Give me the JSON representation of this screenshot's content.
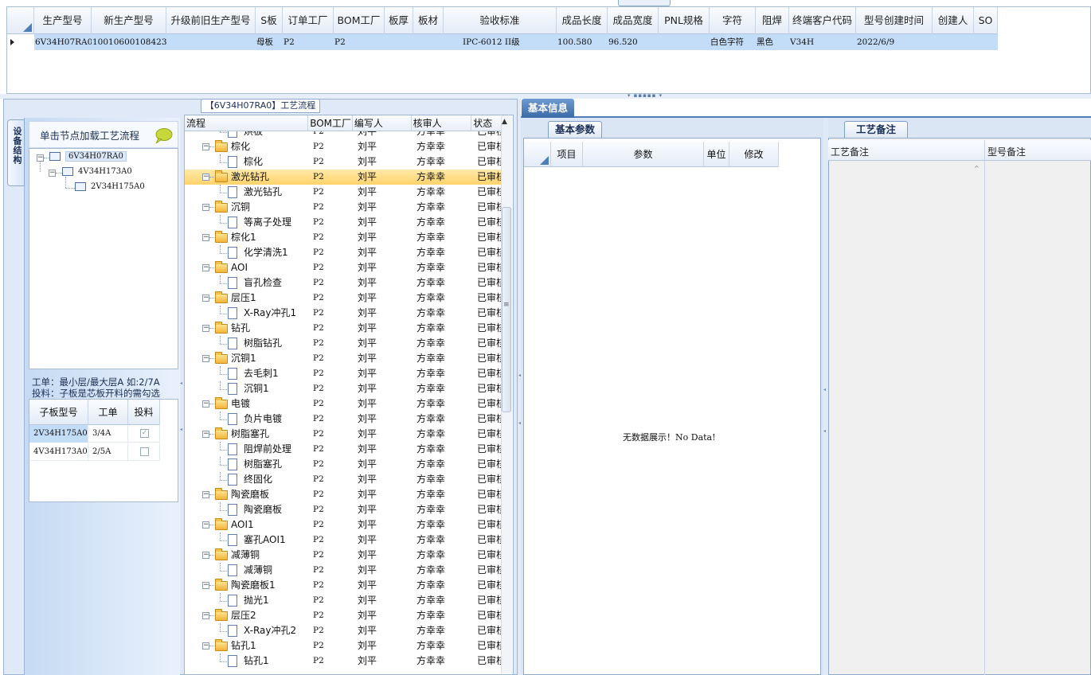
{
  "top_grid": {
    "columns": [
      "生产型号",
      "新生产型号",
      "升级前旧生产型号",
      "S板",
      "订单工厂",
      "BOM工厂",
      "板厚",
      "板材",
      "验收标准",
      "成品长度",
      "成品宽度",
      "PNL规格",
      "字符",
      "阻焊",
      "终端客户代码",
      "型号创建时间",
      "创建人",
      "SO"
    ],
    "row": [
      "6V34H07RA0",
      "10010600108423",
      "",
      "母板",
      "P2",
      "P2",
      "",
      "",
      "IPC-6012 II级",
      "100.580",
      "96.520",
      "",
      "白色字符",
      "黑色",
      "V34H",
      "2022/6/9",
      "",
      ""
    ]
  },
  "left_panel": {
    "caption": "【6V34H07RA0】工艺流程",
    "side_tab": "设备结构",
    "tip": "单击节点加载工艺流程",
    "tree": [
      {
        "label": "6V34H07RA0",
        "level": 0
      },
      {
        "label": "4V34H173A0",
        "level": 1
      },
      {
        "label": "2V34H175A0",
        "level": 2
      }
    ],
    "note_line1": "工单：最小层/最大层A 如:2/7A",
    "note_line2": "投料：子板是芯板开料的需勾选",
    "sub_grid": {
      "columns": [
        "子板型号",
        "工单",
        "投料"
      ],
      "rows": [
        {
          "model": "2V34H175A0",
          "order": "3/4A",
          "feed": true
        },
        {
          "model": "4V34H173A0",
          "order": "2/5A",
          "feed": false
        }
      ]
    }
  },
  "process": {
    "columns": [
      "流程",
      "BOM工厂",
      "编写人",
      "核审人",
      "状态"
    ],
    "rows": [
      {
        "name": "烘板",
        "type": "doc",
        "bom": "P2",
        "writer": "刘平",
        "reviewer": "方幸幸",
        "status": "已审核"
      },
      {
        "name": "棕化",
        "type": "folder",
        "bom": "P2",
        "writer": "刘平",
        "reviewer": "方幸幸",
        "status": "已审核"
      },
      {
        "name": "棕化",
        "type": "doc",
        "bom": "P2",
        "writer": "刘平",
        "reviewer": "方幸幸",
        "status": "已审核"
      },
      {
        "name": "激光钻孔",
        "type": "folder",
        "bom": "P2",
        "writer": "刘平",
        "reviewer": "方幸幸",
        "status": "已审核",
        "selected": true
      },
      {
        "name": "激光钻孔",
        "type": "doc",
        "bom": "P2",
        "writer": "刘平",
        "reviewer": "方幸幸",
        "status": "已审核"
      },
      {
        "name": "沉铜",
        "type": "folder",
        "bom": "P2",
        "writer": "刘平",
        "reviewer": "方幸幸",
        "status": "已审核"
      },
      {
        "name": "等离子处理",
        "type": "doc",
        "bom": "P2",
        "writer": "刘平",
        "reviewer": "方幸幸",
        "status": "已审核"
      },
      {
        "name": "棕化1",
        "type": "folder",
        "bom": "P2",
        "writer": "刘平",
        "reviewer": "方幸幸",
        "status": "已审核"
      },
      {
        "name": "化学清洗1",
        "type": "doc",
        "bom": "P2",
        "writer": "刘平",
        "reviewer": "方幸幸",
        "status": "已审核"
      },
      {
        "name": "AOI",
        "type": "folder",
        "bom": "P2",
        "writer": "刘平",
        "reviewer": "方幸幸",
        "status": "已审核"
      },
      {
        "name": "盲孔检查",
        "type": "doc",
        "bom": "P2",
        "writer": "刘平",
        "reviewer": "方幸幸",
        "status": "已审核"
      },
      {
        "name": "层压1",
        "type": "folder",
        "bom": "P2",
        "writer": "刘平",
        "reviewer": "方幸幸",
        "status": "已审核"
      },
      {
        "name": "X-Ray冲孔1",
        "type": "doc",
        "bom": "P2",
        "writer": "刘平",
        "reviewer": "方幸幸",
        "status": "已审核"
      },
      {
        "name": "钻孔",
        "type": "folder",
        "bom": "P2",
        "writer": "刘平",
        "reviewer": "方幸幸",
        "status": "已审核"
      },
      {
        "name": "树脂钻孔",
        "type": "doc",
        "bom": "P2",
        "writer": "刘平",
        "reviewer": "方幸幸",
        "status": "已审核"
      },
      {
        "name": "沉铜1",
        "type": "folder",
        "bom": "P2",
        "writer": "刘平",
        "reviewer": "方幸幸",
        "status": "已审核"
      },
      {
        "name": "去毛刺1",
        "type": "doc",
        "bom": "P2",
        "writer": "刘平",
        "reviewer": "方幸幸",
        "status": "已审核"
      },
      {
        "name": "沉铜1",
        "type": "doc",
        "bom": "P2",
        "writer": "刘平",
        "reviewer": "方幸幸",
        "status": "已审核"
      },
      {
        "name": "电镀",
        "type": "folder",
        "bom": "P2",
        "writer": "刘平",
        "reviewer": "方幸幸",
        "status": "已审核"
      },
      {
        "name": "负片电镀",
        "type": "doc",
        "bom": "P2",
        "writer": "刘平",
        "reviewer": "方幸幸",
        "status": "已审核"
      },
      {
        "name": "树脂塞孔",
        "type": "folder",
        "bom": "P2",
        "writer": "刘平",
        "reviewer": "方幸幸",
        "status": "已审核"
      },
      {
        "name": "阻焊前处理",
        "type": "doc",
        "bom": "P2",
        "writer": "刘平",
        "reviewer": "方幸幸",
        "status": "已审核"
      },
      {
        "name": "树脂塞孔",
        "type": "doc",
        "bom": "P2",
        "writer": "刘平",
        "reviewer": "方幸幸",
        "status": "已审核"
      },
      {
        "name": "终固化",
        "type": "doc",
        "bom": "P2",
        "writer": "刘平",
        "reviewer": "方幸幸",
        "status": "已审核"
      },
      {
        "name": "陶瓷磨板",
        "type": "folder",
        "bom": "P2",
        "writer": "刘平",
        "reviewer": "方幸幸",
        "status": "已审核"
      },
      {
        "name": "陶瓷磨板",
        "type": "doc",
        "bom": "P2",
        "writer": "刘平",
        "reviewer": "方幸幸",
        "status": "已审核"
      },
      {
        "name": "AOI1",
        "type": "folder",
        "bom": "P2",
        "writer": "刘平",
        "reviewer": "方幸幸",
        "status": "已审核"
      },
      {
        "name": "塞孔AOI1",
        "type": "doc",
        "bom": "P2",
        "writer": "刘平",
        "reviewer": "方幸幸",
        "status": "已审核"
      },
      {
        "name": "减薄铜",
        "type": "folder",
        "bom": "P2",
        "writer": "刘平",
        "reviewer": "方幸幸",
        "status": "已审核"
      },
      {
        "name": "减薄铜",
        "type": "doc",
        "bom": "P2",
        "writer": "刘平",
        "reviewer": "方幸幸",
        "status": "已审核"
      },
      {
        "name": "陶瓷磨板1",
        "type": "folder",
        "bom": "P2",
        "writer": "刘平",
        "reviewer": "方幸幸",
        "status": "已审核"
      },
      {
        "name": "抛光1",
        "type": "doc",
        "bom": "P2",
        "writer": "刘平",
        "reviewer": "方幸幸",
        "status": "已审核"
      },
      {
        "name": "层压2",
        "type": "folder",
        "bom": "P2",
        "writer": "刘平",
        "reviewer": "方幸幸",
        "status": "已审核"
      },
      {
        "name": "X-Ray冲孔2",
        "type": "doc",
        "bom": "P2",
        "writer": "刘平",
        "reviewer": "方幸幸",
        "status": "已审核"
      },
      {
        "name": "钻孔1",
        "type": "folder",
        "bom": "P2",
        "writer": "刘平",
        "reviewer": "方幸幸",
        "status": "已审核"
      },
      {
        "name": "钻孔1",
        "type": "doc",
        "bom": "P2",
        "writer": "刘平",
        "reviewer": "方幸幸",
        "status": "已审核"
      }
    ]
  },
  "right": {
    "tab_basic_info": "基本信息",
    "tab_params": "基本参数",
    "params_columns": [
      "项目",
      "参数",
      "单位",
      "修改"
    ],
    "no_data": "无数据展示！No Data!",
    "tab_remark": "工艺备注",
    "remark_col_left": "工艺备注",
    "remark_col_right": "型号备注"
  },
  "colors": {
    "accent": "#4f7eb8",
    "selection_row": "#c3dcf7",
    "highlight_row": "#ffd36b",
    "panel_bg": "#dfe9f7"
  }
}
